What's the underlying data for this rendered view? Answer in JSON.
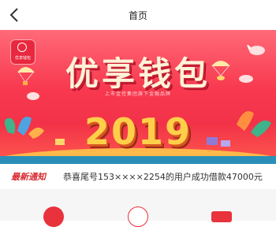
{
  "nav": {
    "title": "首页"
  },
  "banner": {
    "logo_text": "优享钱包",
    "headline": "优享钱包",
    "subtitle": "上市金控集团旗下金融品牌",
    "year": "2019"
  },
  "notice": {
    "tag": "最新通知",
    "text": "恭喜尾号153××××2254的用户成功借款47000元"
  },
  "quick_icons": [
    "calculator-icon",
    "yuan-icon",
    "card-icon"
  ],
  "colors": {
    "accent": "#e8323c",
    "banner": "#f8384e"
  }
}
